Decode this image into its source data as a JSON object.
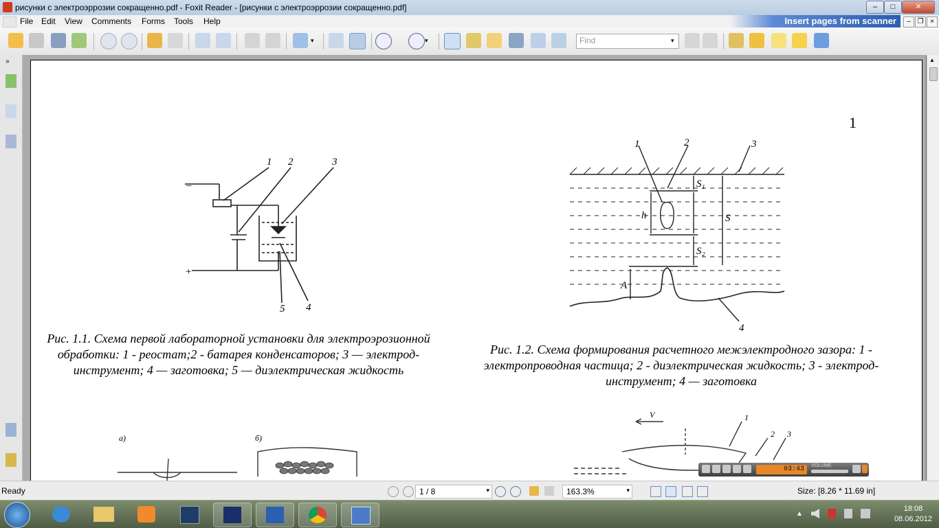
{
  "window": {
    "title": "рисунки с электроэррозии сокращенно.pdf - Foxit Reader - [рисунки с электроэррозии сокращенно.pdf]",
    "controls": [
      "–",
      "□",
      "✕"
    ]
  },
  "menu": {
    "items": [
      "File",
      "Edit",
      "View",
      "Comments",
      "Forms",
      "Tools",
      "Help"
    ],
    "banner": "Insert pages from scanner",
    "mdi_controls": [
      "–",
      "❐",
      "×"
    ]
  },
  "toolbar": {
    "find_placeholder": "Find"
  },
  "page": {
    "number": "1",
    "fig1": {
      "labels": {
        "minus": "–",
        "plus": "+",
        "n1": "1",
        "n2": "2",
        "n3": "3",
        "n4": "4",
        "n5": "5"
      },
      "caption": "Рис. 1.1. Схема первой лабораторной установки для электроэрозионной обработки: 1 - реостат;2 - батарея конденсаторов; 3 — электрод-инструмент; 4 — заготовка; 5 — диэлектрическая жидкость"
    },
    "fig2": {
      "labels": {
        "n1": "1",
        "n2": "2",
        "n3": "3",
        "n4": "4",
        "s1": "S₁",
        "s2": "S₂",
        "s": "S",
        "hr": "h",
        "a": "A"
      },
      "caption": "Рис. 1.2. Схема формирования расчетного межэлектродного зазора: 1 - электропроводная частица; 2 - диэлектрическая жидкость; 3 - электрод-инструмент; 4 — заготовка"
    },
    "fig3": {
      "label_a": "a)",
      "label_b": "б)"
    },
    "fig4": {
      "labels": {
        "n1": "1",
        "n2": "2",
        "n3": "3",
        "v": "V"
      }
    }
  },
  "status": {
    "left": "Ready",
    "page_display": "1 / 8",
    "zoom": "163.3%",
    "size": "Size: [8.26 * 11.69 in]"
  },
  "media": {
    "time": "03:43",
    "volume_label": "VOLUME"
  },
  "taskbar": {
    "apps": [
      "internet-explorer",
      "file-explorer",
      "media-center",
      "photoshop",
      "save-app",
      "word",
      "chrome",
      "foxit-reader"
    ],
    "time": "18:08",
    "date": "08.06.2012"
  }
}
